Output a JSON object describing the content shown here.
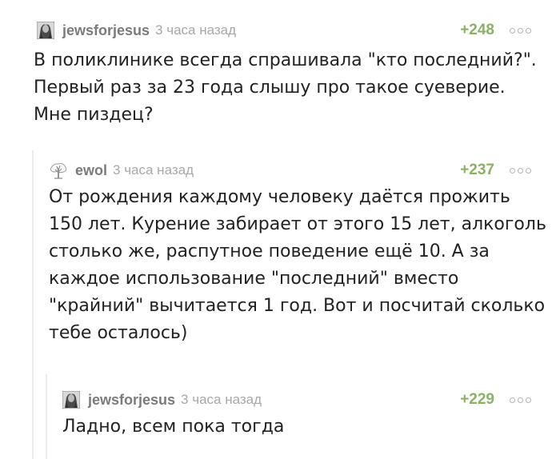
{
  "comments": [
    {
      "username": "jewsforjesus",
      "time": "3 часа назад",
      "rating": "+248",
      "avatar_icon": "user-avatar-photo",
      "lines": [
        "В поликлинике всегда спрашивала \"кто последний?\".",
        "Первый раз за 23 года слышу про такое суеверие.",
        "Мне пиздец?"
      ]
    },
    {
      "username": "ewol",
      "time": "3 часа назад",
      "rating": "+237",
      "avatar_icon": "tree-avatar-icon",
      "lines": [
        "От рождения каждому человеку даётся прожить",
        "150 лет. Курение забирает от этого 15 лет, алкоголь",
        "столько же, распутное поведение ещё 10. А за",
        "каждое использование \"последний\" вместо",
        "\"крайний\" вычитается 1 год. Вот и посчитай сколько",
        "тебе осталось)"
      ]
    },
    {
      "username": "jewsforjesus",
      "time": "3 часа назад",
      "rating": "+229",
      "avatar_icon": "user-avatar-photo",
      "lines": [
        "Ладно, всем пока тогда"
      ]
    }
  ],
  "colors": {
    "rating": "#8ab166",
    "username": "#7b7b7b",
    "time": "#a8a8a8",
    "text": "#222222",
    "thread_line": "#ececec"
  }
}
